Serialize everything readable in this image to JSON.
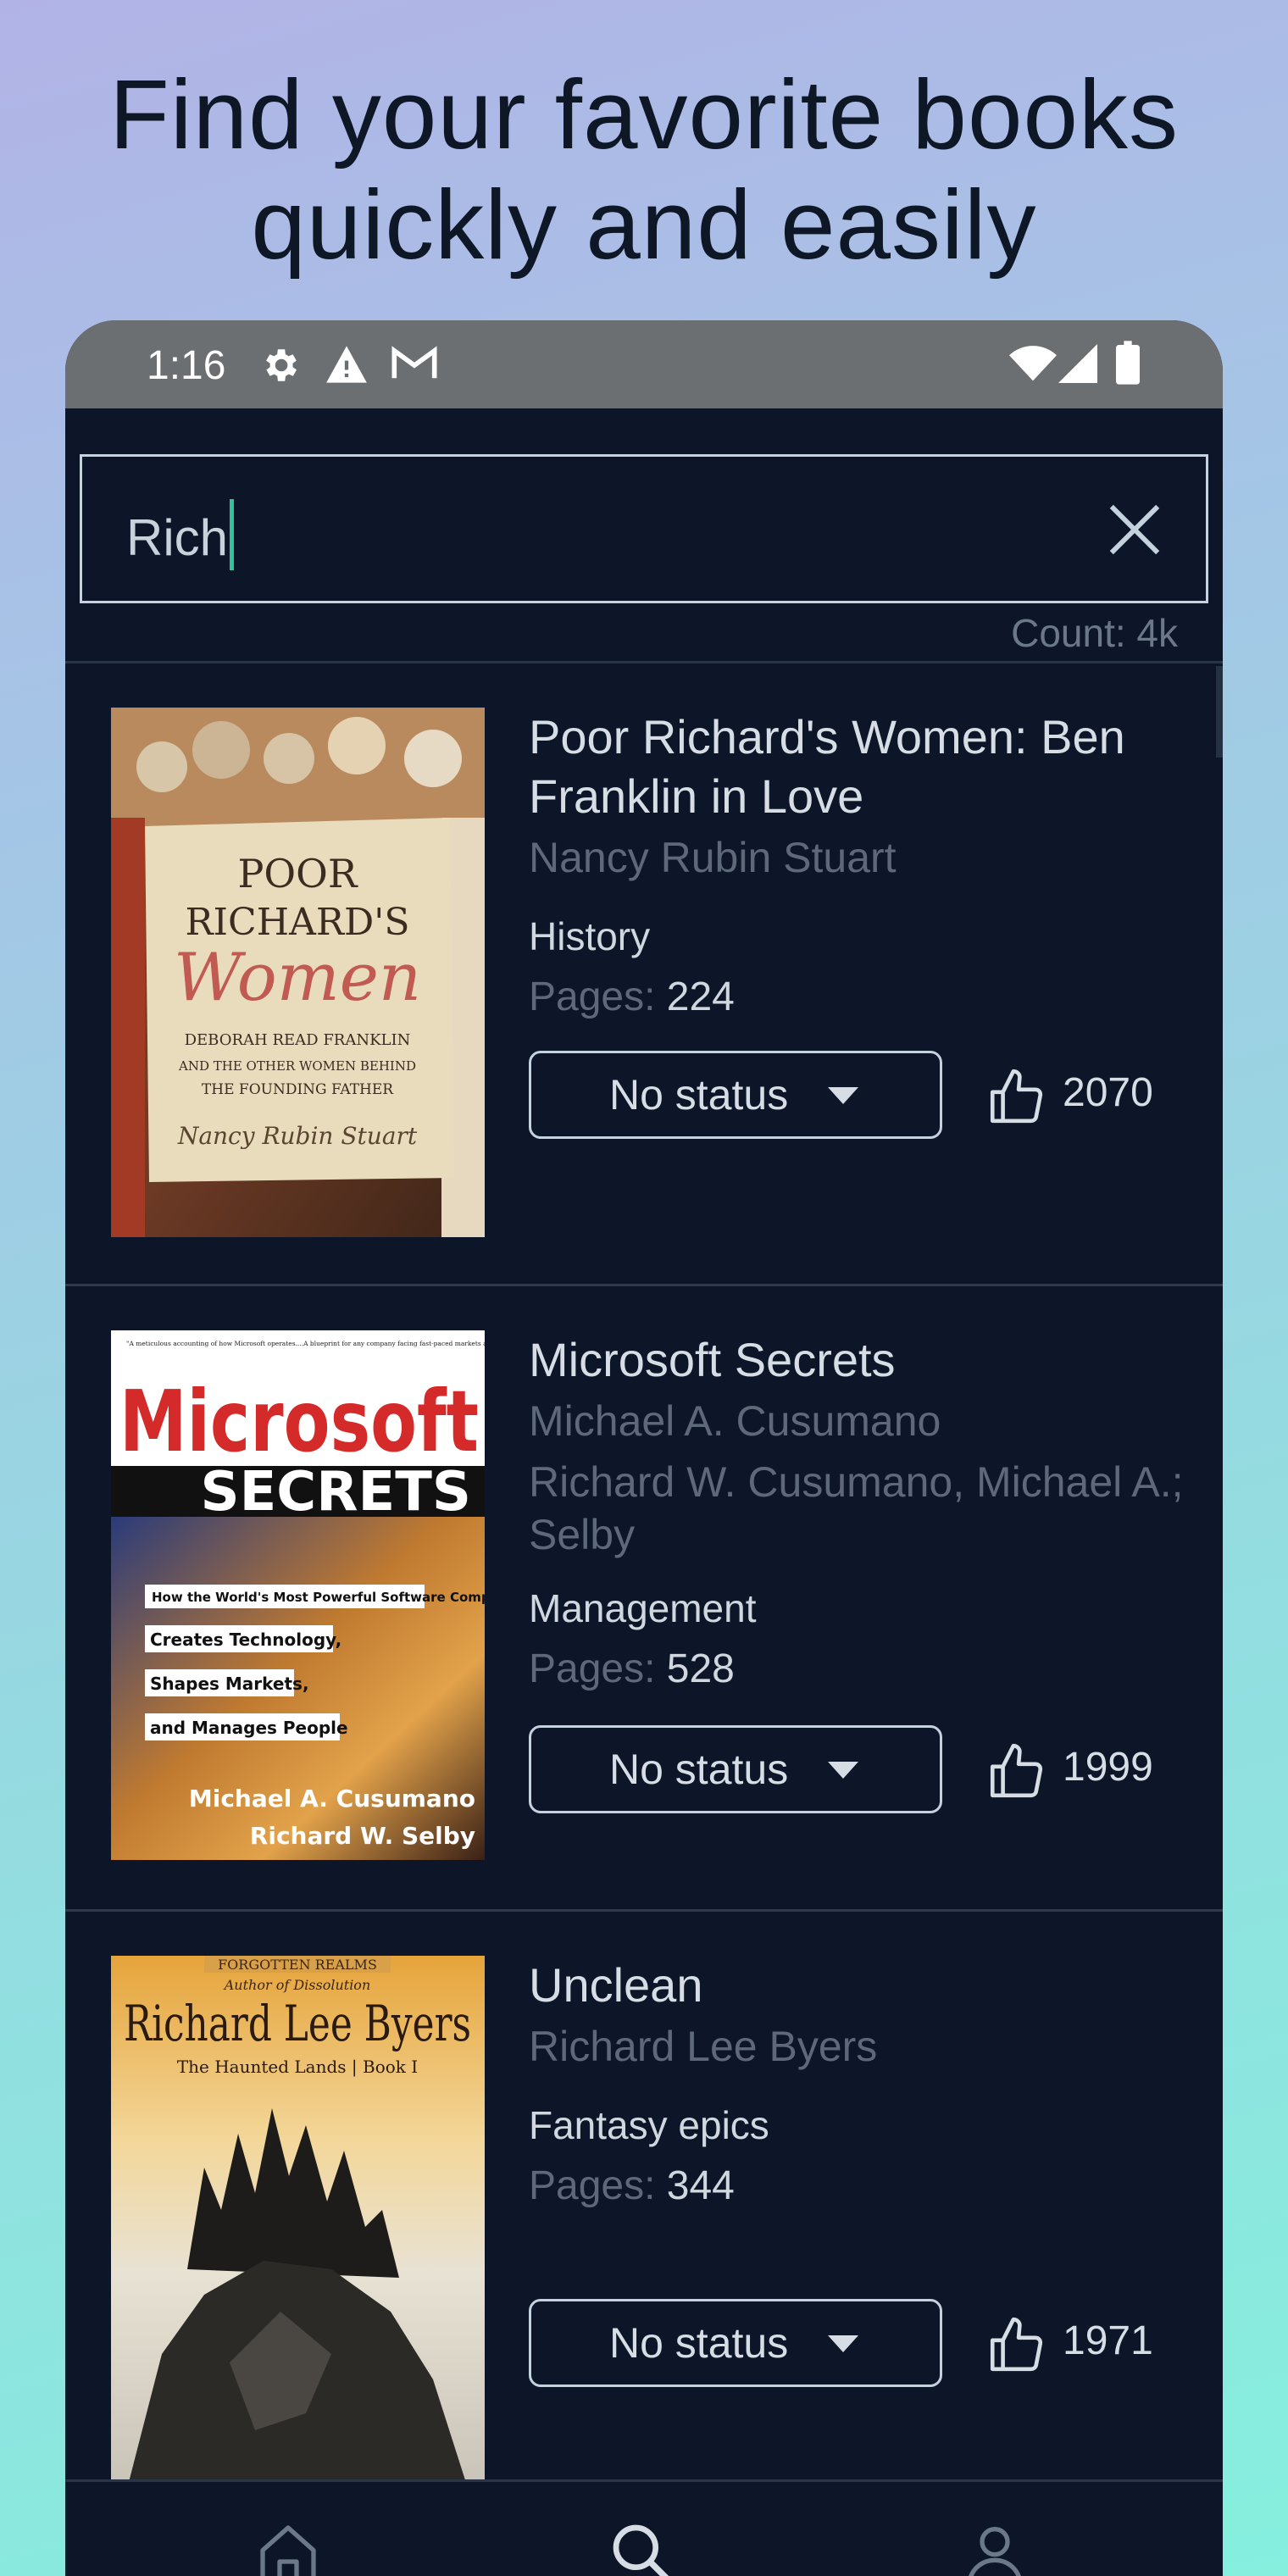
{
  "headline": {
    "line1": "Find your favorite books",
    "line2": "quickly and easily"
  },
  "status_bar": {
    "time": "1:16",
    "left_icons": [
      "gear-icon",
      "warning-icon",
      "gmail-icon"
    ],
    "right_icons": [
      "wifi-icon",
      "signal-icon",
      "battery-icon"
    ]
  },
  "search": {
    "value": "Rich",
    "count_label": "Count: 4k"
  },
  "books": [
    {
      "title": "Poor Richard's Women: Ben Franklin in Love",
      "authors": [
        "Nancy Rubin Stuart"
      ],
      "genre": "History",
      "pages_label": "Pages:",
      "pages": "224",
      "status": "No status",
      "likes": "2070",
      "cover": {
        "line1": "POOR",
        "line2": "RICHARD'S",
        "line3": "Women",
        "line4": "DEBORAH READ FRANKLIN",
        "line5": "AND THE OTHER WOMEN BEHIND",
        "line6": "THE FOUNDING FATHER",
        "author": "Nancy Rubin Stuart"
      }
    },
    {
      "title": "Microsoft Secrets",
      "authors": [
        "Michael A. Cusumano",
        "Richard W. Cusumano, Michael A.; Selby"
      ],
      "genre": "Management",
      "pages_label": "Pages:",
      "pages": "528",
      "status": "No status",
      "likes": "1999",
      "cover": {
        "top": "\"A meticulous accounting of how Microsoft operates....A blueprint for any company facing fast-paced markets and harrowing competition.\" —Business Week",
        "title1": "Microsoft",
        "title2": "SECRETS",
        "tag1": "How the World's Most Powerful Software Company",
        "tag2": "Creates Technology,",
        "tag3": "Shapes Markets,",
        "tag4": "and Manages People",
        "author1": "Michael A. Cusumano",
        "author2": "Richard W. Selby"
      }
    },
    {
      "title": "Unclean",
      "authors": [
        "Richard Lee Byers"
      ],
      "genre": "Fantasy epics",
      "pages_label": "Pages:",
      "pages": "344",
      "status": "No status",
      "likes": "1971",
      "cover": {
        "banner": "FORGOTTEN REALMS",
        "sub": "Author of Dissolution",
        "author": "Richard Lee Byers",
        "series": "The Haunted Lands | Book I"
      }
    }
  ],
  "bottom_nav": [
    "home-icon",
    "search-icon",
    "profile-icon"
  ],
  "colors": {
    "background": "#0c1628",
    "accent": "#33c19a",
    "text_primary": "#d6dde5",
    "text_muted": "#5d6878"
  }
}
